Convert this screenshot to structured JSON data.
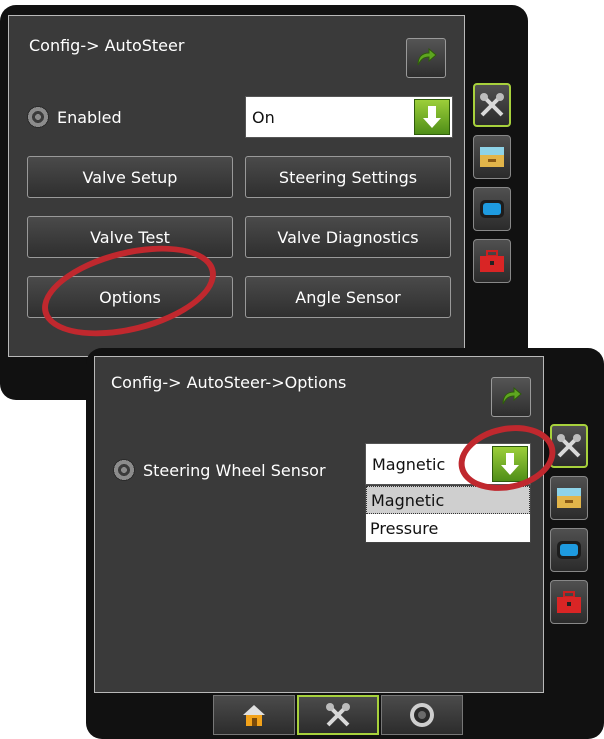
{
  "screen1": {
    "title": "Config-> AutoSteer",
    "enabled_label": "Enabled",
    "enabled_value": "On",
    "buttons": {
      "valve_setup": "Valve Setup",
      "steering_settings": "Steering Settings",
      "valve_test": "Valve Test",
      "valve_diagnostics": "Valve Diagnostics",
      "options": "Options",
      "angle_sensor": "Angle Sensor"
    }
  },
  "screen2": {
    "title": "Config-> AutoSteer->Options",
    "sensor_label": "Steering Wheel Sensor",
    "sensor_value": "Magnetic",
    "options": [
      "Magnetic",
      "Pressure"
    ]
  },
  "icons": {
    "side_tabs": [
      "tools-icon",
      "drawer-icon",
      "monitor-icon",
      "toolbox-icon"
    ],
    "bottom_tabs": [
      "home-icon",
      "tools-icon",
      "camera-icon"
    ],
    "back": "back-arrow-icon"
  },
  "colors": {
    "highlight": "#c0282e",
    "active_border": "#a7d13c",
    "arrow_green": "#5ea620"
  }
}
